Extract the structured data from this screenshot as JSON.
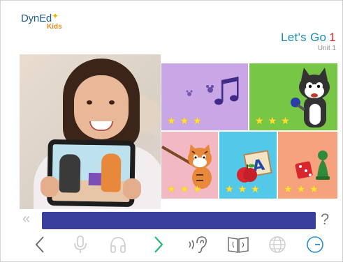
{
  "header": {
    "logo_text": "DynEd",
    "logo_sub": "Kids",
    "course_title": "Let's Go",
    "course_number": "1",
    "unit_label": "Unit 1"
  },
  "lessons": [
    {
      "name": "music",
      "stars_earned": 3,
      "stars_total": 3
    },
    {
      "name": "cat",
      "stars_earned": 3,
      "stars_total": 3
    },
    {
      "name": "tiger",
      "stars_earned": 3,
      "stars_total": 3
    },
    {
      "name": "abc",
      "stars_earned": 3,
      "stars_total": 3
    },
    {
      "name": "game",
      "stars_earned": 3,
      "stars_total": 3
    }
  ],
  "progress": {
    "value": 1.0
  },
  "help_label": "?",
  "back_label": "«",
  "toolbar": {
    "icons": [
      "back-icon",
      "microphone-icon",
      "headphones-icon",
      "next-icon",
      "ear-icon",
      "book-icon",
      "globe-icon",
      "clock-icon"
    ]
  },
  "colors": {
    "accent_teal": "#1a8fb0",
    "accent_red": "#d8262e",
    "bar_blue": "#3a3f9c",
    "next_green": "#2bb673",
    "tile_purple": "#c9a6e6",
    "tile_green": "#78c646",
    "tile_pink": "#f2b8c4",
    "tile_blue": "#54c8e8",
    "tile_orange": "#f6a27c",
    "star_yellow": "#ffe135"
  }
}
